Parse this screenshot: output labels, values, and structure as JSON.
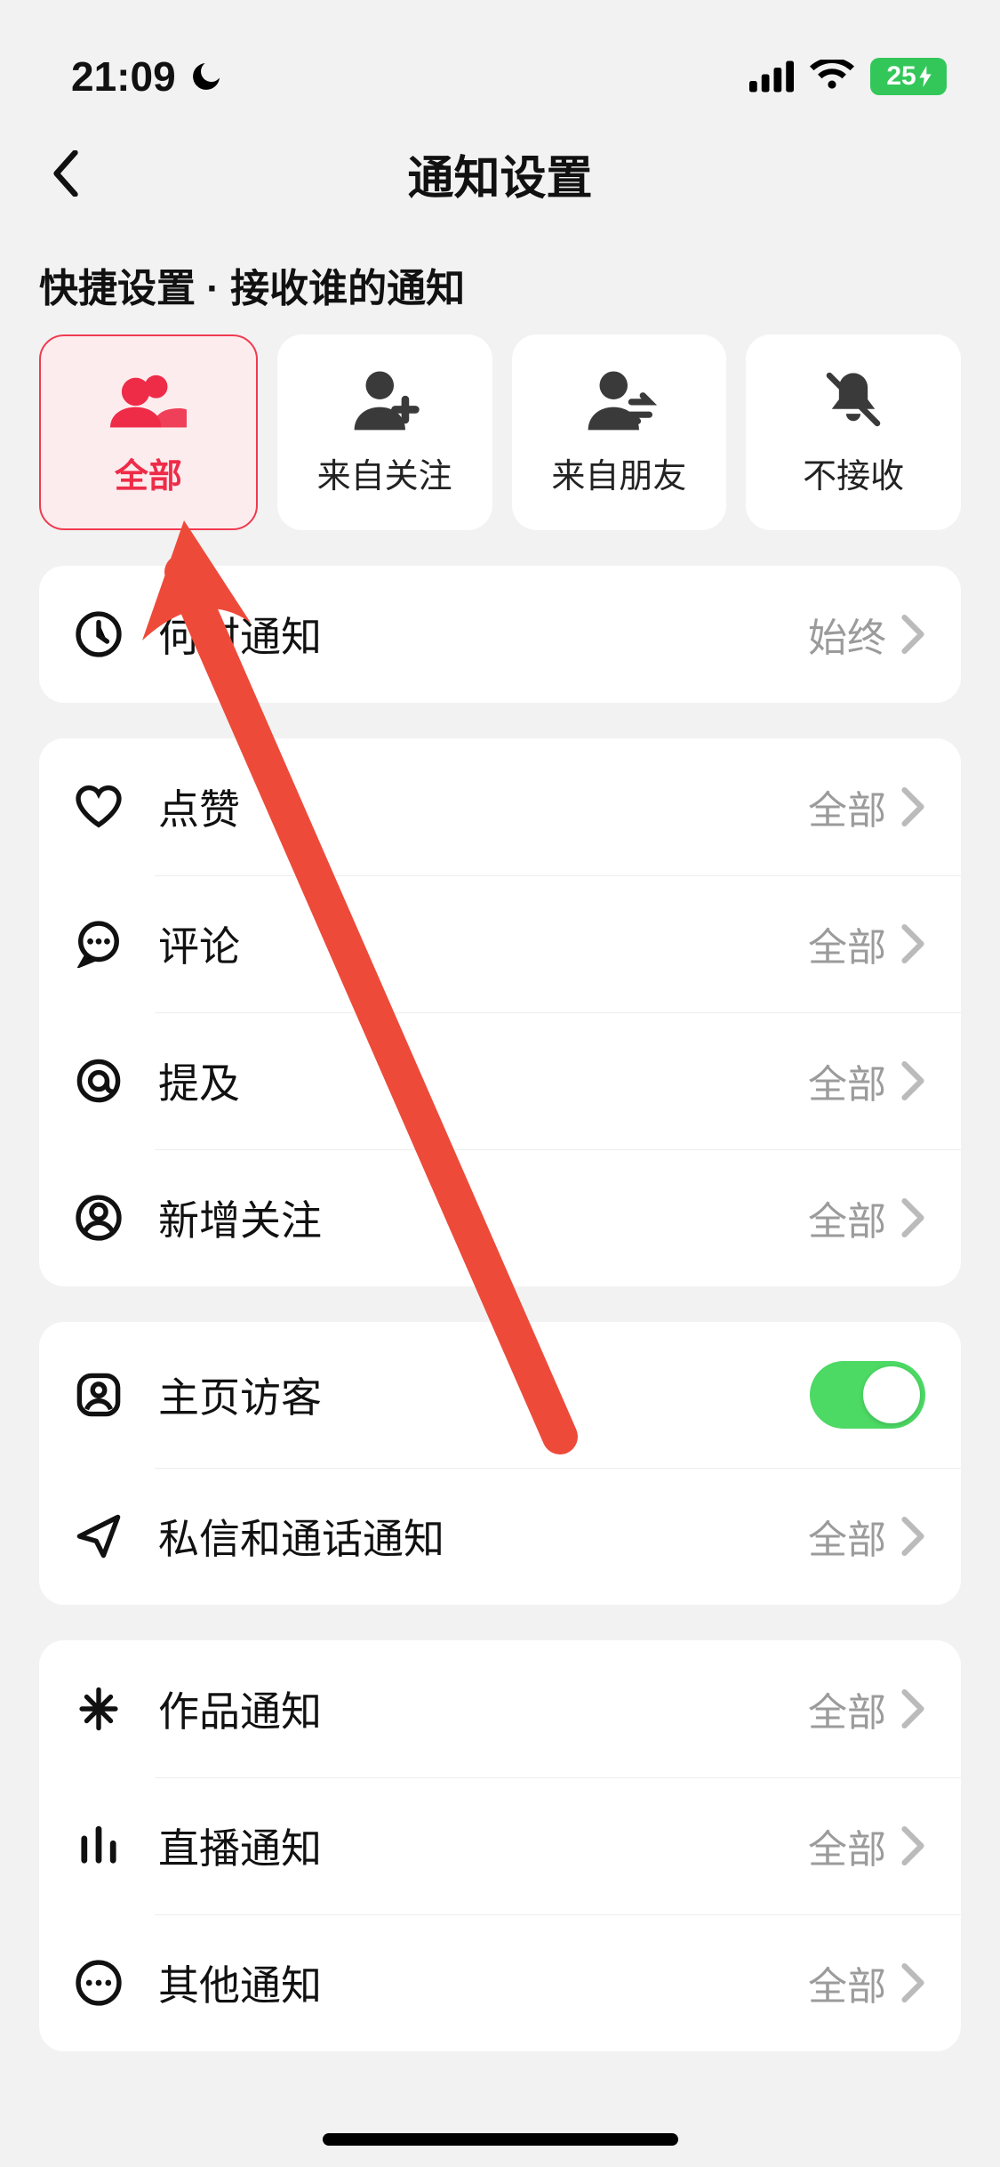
{
  "status": {
    "time": "21:09",
    "battery": "25"
  },
  "header": {
    "title": "通知设置"
  },
  "quick": {
    "title": "快捷设置 · 接收谁的通知",
    "tiles": [
      {
        "label": "全部"
      },
      {
        "label": "来自关注"
      },
      {
        "label": "来自朋友"
      },
      {
        "label": "不接收"
      }
    ]
  },
  "group_when": [
    {
      "label": "何时通知",
      "value": "始终"
    }
  ],
  "group_interactions": [
    {
      "label": "点赞",
      "value": "全部"
    },
    {
      "label": "评论",
      "value": "全部"
    },
    {
      "label": "提及",
      "value": "全部"
    },
    {
      "label": "新增关注",
      "value": "全部"
    }
  ],
  "group_visitors": [
    {
      "label": "主页访客"
    },
    {
      "label": "私信和通话通知",
      "value": "全部"
    }
  ],
  "group_content": [
    {
      "label": "作品通知",
      "value": "全部"
    },
    {
      "label": "直播通知",
      "value": "全部"
    },
    {
      "label": "其他通知",
      "value": "全部"
    }
  ]
}
